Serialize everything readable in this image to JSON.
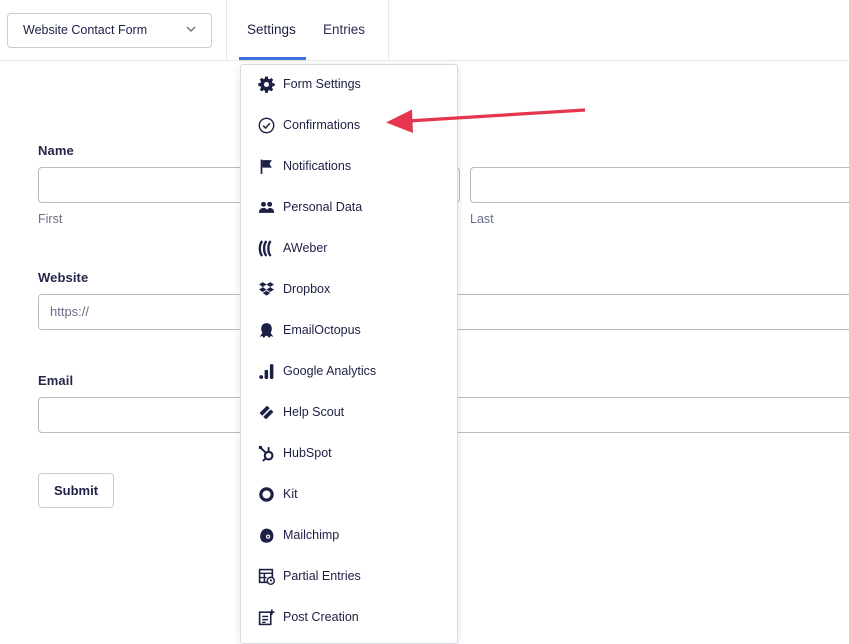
{
  "header": {
    "form_selector": "Website Contact Form",
    "tabs": [
      {
        "label": "Settings",
        "active": true
      },
      {
        "label": "Entries",
        "active": false
      }
    ]
  },
  "form": {
    "name": {
      "label": "Name",
      "first_sublabel": "First",
      "last_sublabel": "Last"
    },
    "website": {
      "label": "Website",
      "placeholder": "https://"
    },
    "email": {
      "label": "Email"
    },
    "submit_label": "Submit"
  },
  "settings_menu": {
    "items": [
      {
        "label": "Form Settings",
        "icon": "gear-icon"
      },
      {
        "label": "Confirmations",
        "icon": "check-circle-icon"
      },
      {
        "label": "Notifications",
        "icon": "flag-icon"
      },
      {
        "label": "Personal Data",
        "icon": "users-icon"
      },
      {
        "label": "AWeber",
        "icon": "aweber-icon"
      },
      {
        "label": "Dropbox",
        "icon": "dropbox-icon"
      },
      {
        "label": "EmailOctopus",
        "icon": "octopus-icon"
      },
      {
        "label": "Google Analytics",
        "icon": "analytics-icon"
      },
      {
        "label": "Help Scout",
        "icon": "helpscout-icon"
      },
      {
        "label": "HubSpot",
        "icon": "hubspot-icon"
      },
      {
        "label": "Kit",
        "icon": "kit-icon"
      },
      {
        "label": "Mailchimp",
        "icon": "mailchimp-icon"
      },
      {
        "label": "Partial Entries",
        "icon": "partial-entries-icon"
      },
      {
        "label": "Post Creation",
        "icon": "post-creation-icon"
      }
    ]
  },
  "colors": {
    "accent": "#3e6fd7",
    "annotation_arrow": "#e5354f",
    "text": "#1d2045"
  }
}
